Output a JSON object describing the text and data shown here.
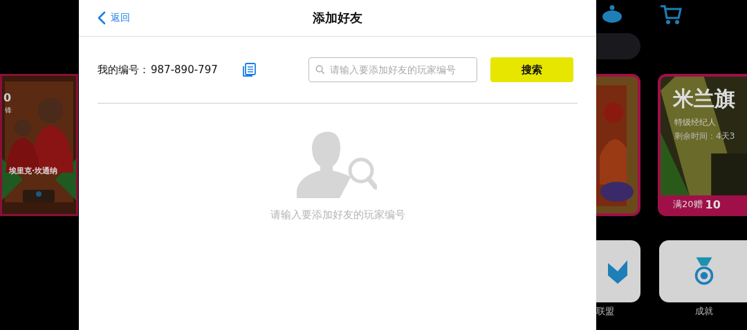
{
  "background": {
    "player_card": {
      "rating": "0",
      "position": "锋",
      "name": "埃里克·坎通纳"
    },
    "promo_card": {
      "title": "米兰旗",
      "subtitle": "特级经纪人",
      "time_left": "剩余时间：4天3",
      "reward": "满20赠",
      "reward_count": "10"
    },
    "shortcuts": [
      {
        "label": "联盟"
      },
      {
        "label": "成就"
      }
    ]
  },
  "dialog": {
    "back": "返回",
    "title": "添加好友",
    "my_id_label": "我的编号：",
    "my_id": "987-890-797",
    "search": {
      "placeholder": "请输入要添加好友的玩家编号"
    },
    "search_button": "搜索",
    "empty_message": "请输入要添加好友的玩家编号"
  }
}
